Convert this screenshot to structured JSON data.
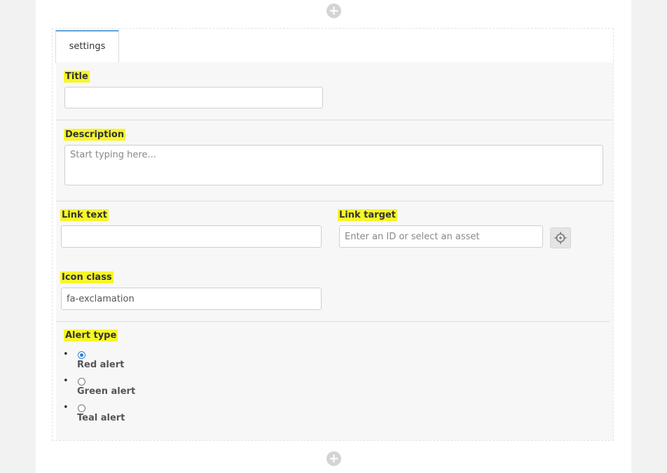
{
  "block": {
    "tab_label": "settings",
    "add_top_icon": "plus-circle-icon",
    "add_bottom_icon": "plus-circle-icon"
  },
  "fields": {
    "title": {
      "label": "Title",
      "value": ""
    },
    "description": {
      "label": "Description",
      "placeholder": "Start typing here..."
    },
    "link_text": {
      "label": "Link text",
      "value": ""
    },
    "link_target": {
      "label": "Link target",
      "placeholder": "Enter an ID or select an asset",
      "picker_icon": "crosshair-icon"
    },
    "icon_class": {
      "label": "Icon class",
      "value": "fa-exclamation"
    }
  },
  "alert_type": {
    "label": "Alert type",
    "options": [
      {
        "label": "Red alert",
        "checked": true
      },
      {
        "label": "Green alert",
        "checked": false
      },
      {
        "label": "Teal alert",
        "checked": false
      }
    ]
  },
  "colors": {
    "highlight": "#f6f62a",
    "tab_accent": "#5ba3d8",
    "radio_selected": "#2b7fd6"
  }
}
